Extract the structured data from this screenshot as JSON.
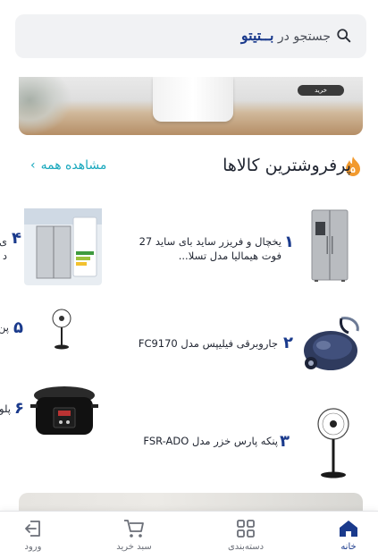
{
  "search": {
    "prefix": "جستجو در",
    "brand": "بــتیتو"
  },
  "banner_top": {
    "button_label": "خرید"
  },
  "best_sellers": {
    "title": "پرفروشترین کالاها",
    "see_all": "مشاهده همه",
    "items": [
      {
        "rank": "۱",
        "name_line1": "یخچال و فریزر ساید بای ساید 27",
        "name_line2": "فوت هیمالیا مدل تسلا..."
      },
      {
        "rank": "۲",
        "name": "جاروبرقی فیلیپس مدل FC9170"
      },
      {
        "rank": "۳",
        "name": "پنکه پارس خزر مدل FSR-ADO"
      },
      {
        "rank": "۴",
        "name_partial_line1": "ی",
        "name_partial_line2": "د"
      },
      {
        "rank": "۵",
        "name_partial": "پن"
      },
      {
        "rank": "۶",
        "name_partial": "پلو"
      }
    ]
  },
  "bottom_nav": {
    "items": [
      {
        "label": "خانه",
        "icon": "home-icon",
        "active": true
      },
      {
        "label": "دسته‌بندی",
        "icon": "grid-icon",
        "active": false
      },
      {
        "label": "سبد خرید",
        "icon": "cart-icon",
        "active": false
      },
      {
        "label": "ورود",
        "icon": "login-icon",
        "active": false
      }
    ]
  },
  "colors": {
    "brand": "#1a3a8c",
    "accent": "#19a8bd",
    "flame": "#f29a2e"
  }
}
